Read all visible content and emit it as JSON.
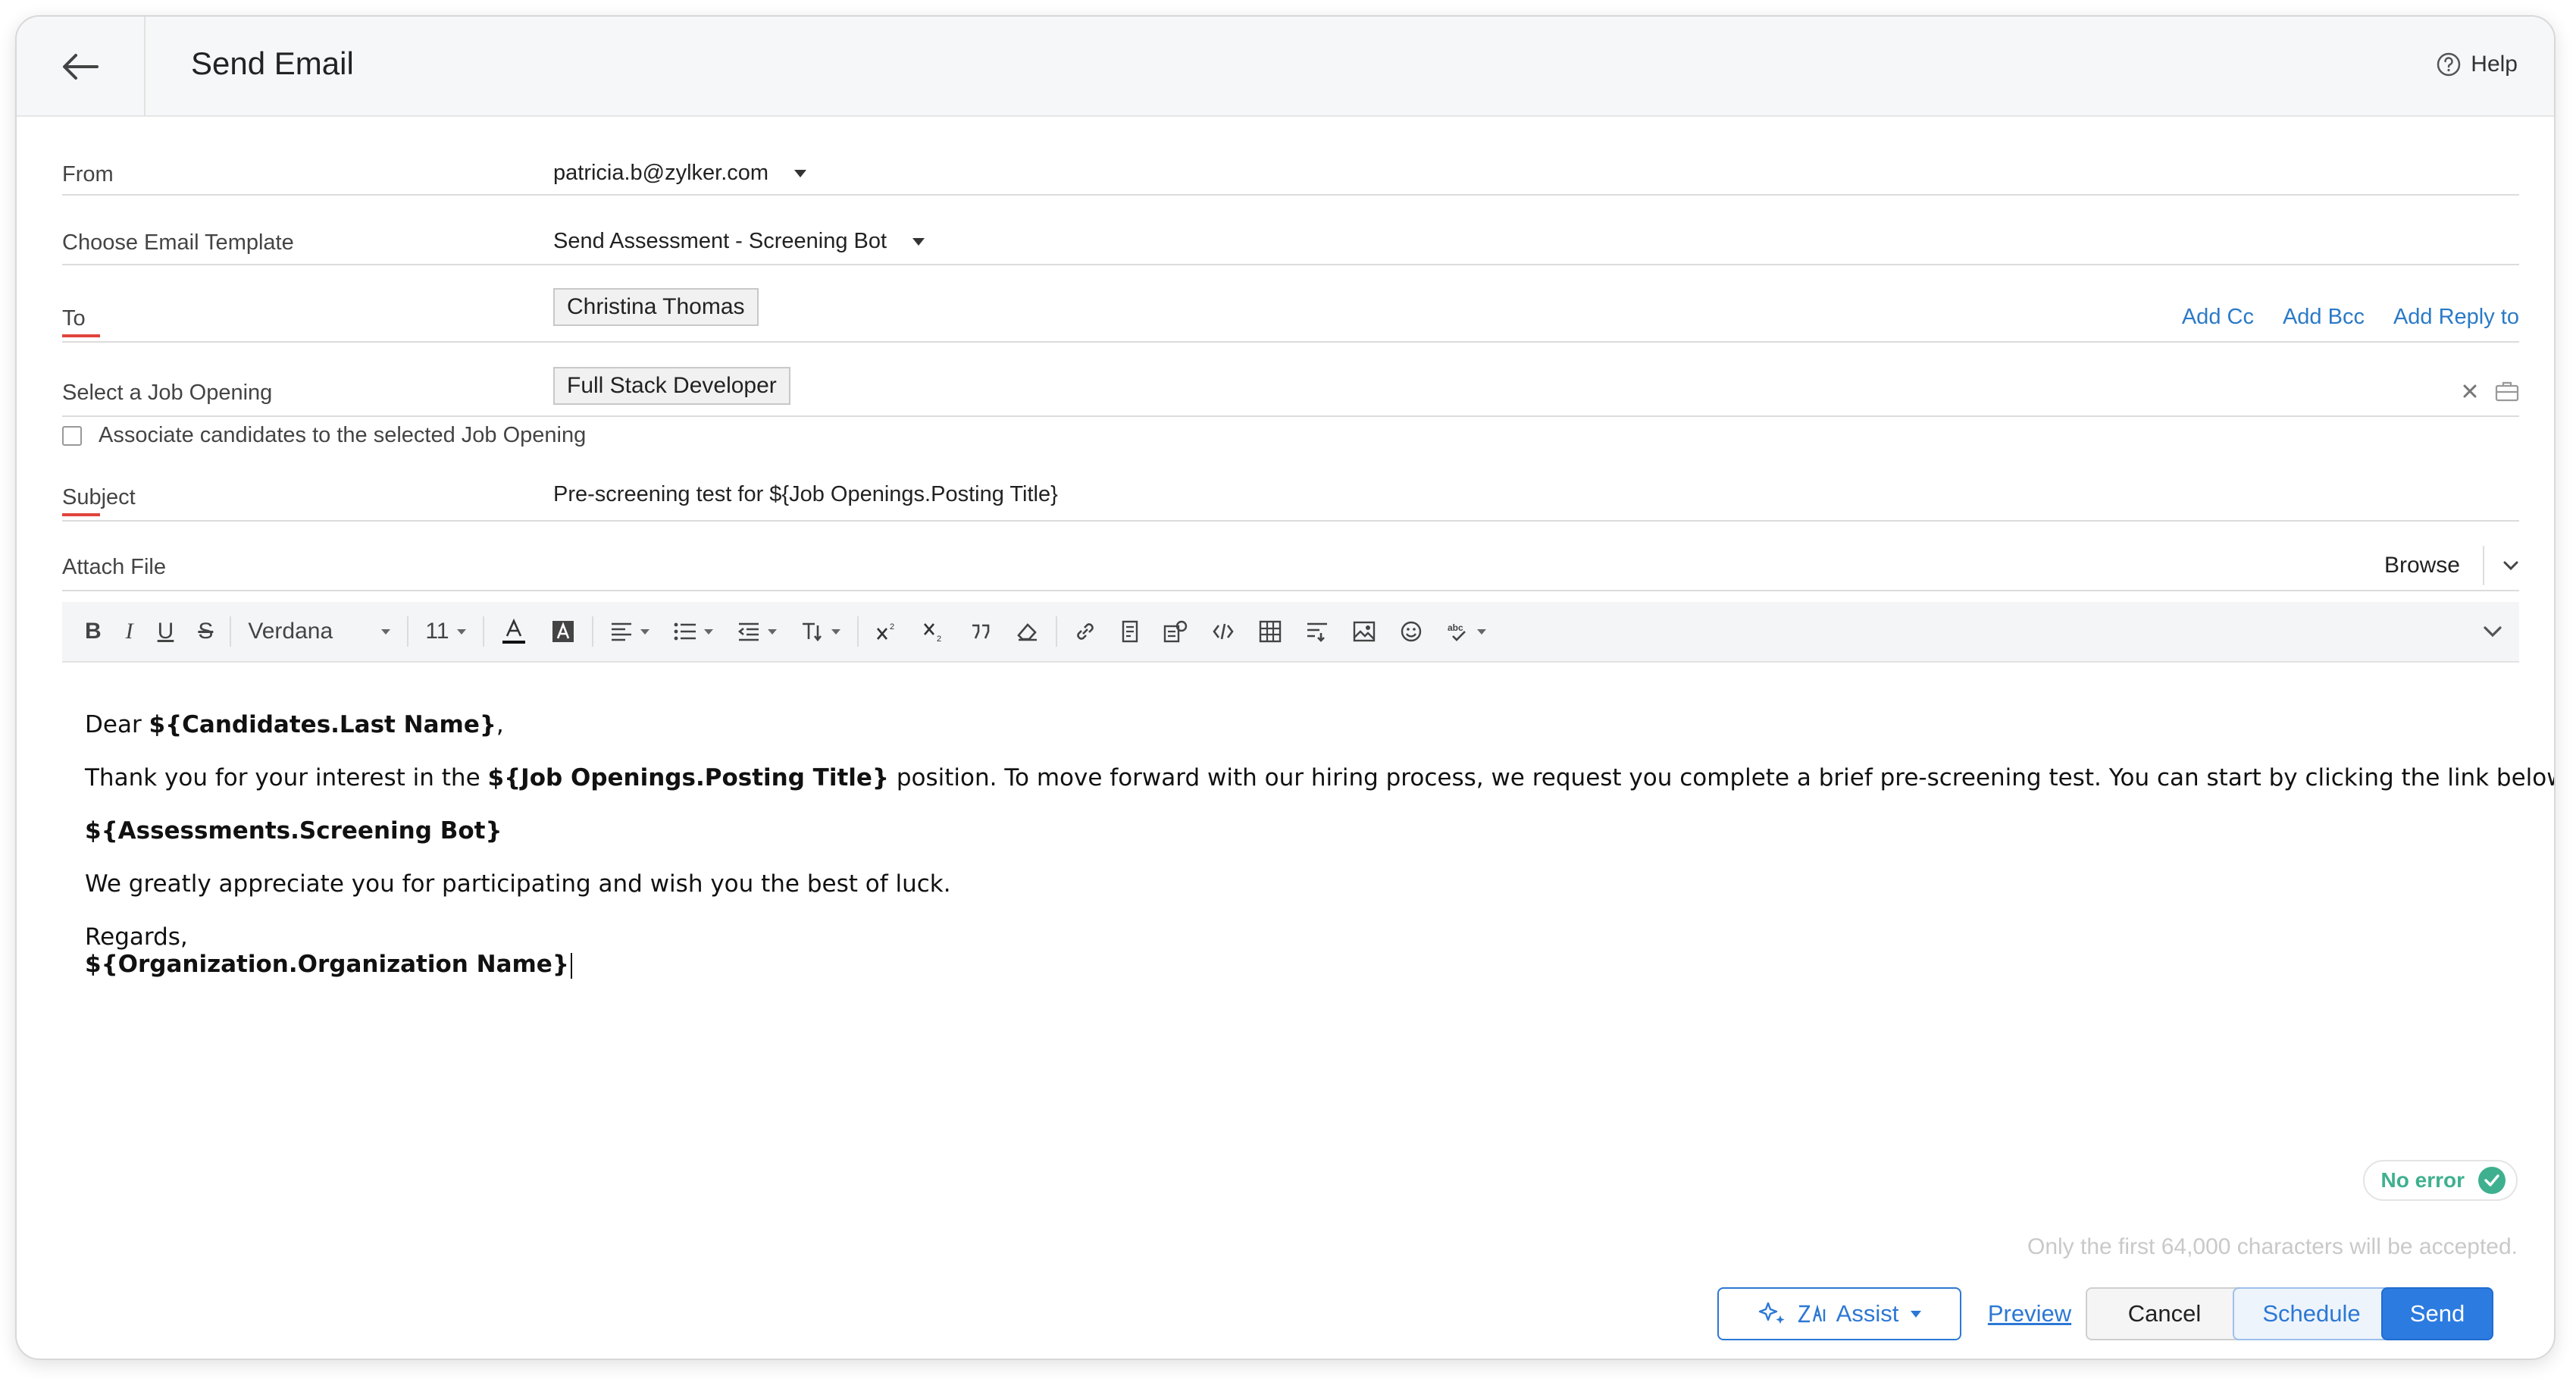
{
  "header": {
    "title": "Send Email",
    "help_label": "Help"
  },
  "form": {
    "from": {
      "label": "From",
      "value": "patricia.b@zylker.com"
    },
    "template": {
      "label": "Choose Email Template",
      "value": "Send Assessment - Screening Bot"
    },
    "to": {
      "label": "To",
      "recipient": "Christina Thomas",
      "add_cc": "Add Cc",
      "add_bcc": "Add Bcc",
      "add_reply_to": "Add Reply to"
    },
    "job_opening": {
      "label": "Select a Job Opening",
      "value": "Full Stack Developer"
    },
    "associate": {
      "label": "Associate candidates to the selected Job Opening",
      "checked": false
    },
    "subject": {
      "label": "Subject",
      "value": "Pre-screening test for ${Job Openings.Posting Title}"
    },
    "attach": {
      "label": "Attach File",
      "browse_label": "Browse"
    }
  },
  "toolbar": {
    "font_family": "Verdana",
    "font_size": "11"
  },
  "body": {
    "greeting_prefix": "Dear ",
    "greeting_var": "${Candidates.Last Name}",
    "greeting_suffix": ",",
    "line2_prefix": "Thank you for your interest in the ",
    "line2_var": "${Job Openings.Posting Title}",
    "line2_suffix": " position. To move forward with our hiring process, we request you complete a brief pre-screening test. You can start by clicking the link below;",
    "assessment_var": "${Assessments.Screening Bot}",
    "line4": "We greatly appreciate you for participating and wish you the best of luck.",
    "regards": "Regards,",
    "org_var": "${Organization.Organization Name}"
  },
  "status": {
    "no_error": "No error",
    "limit_note": "Only the first 64,000 characters will be accepted."
  },
  "footer": {
    "assist": "Assist",
    "preview": "Preview",
    "cancel": "Cancel",
    "schedule": "Schedule",
    "send": "Send"
  },
  "colors": {
    "accent": "#2c7be0",
    "required_marker": "#e0443c",
    "success": "#3fb08f"
  }
}
